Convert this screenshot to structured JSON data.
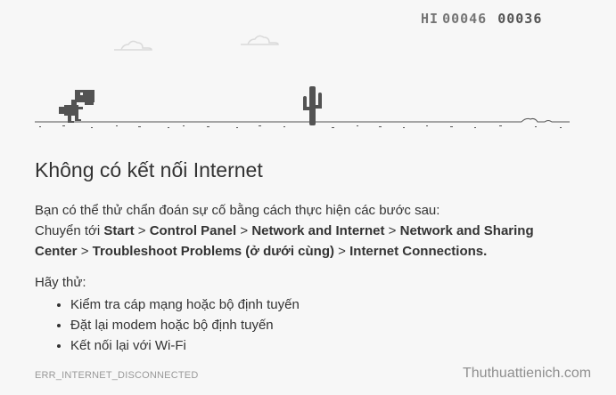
{
  "game": {
    "hi_label": "HI",
    "hi_score": "00046",
    "score": "00036"
  },
  "error": {
    "title": "Không có kết nối Internet",
    "intro": "Bạn có thể thử chẩn đoán sự cố bằng cách thực hiện các bước sau:",
    "path_prefix": "Chuyển tới",
    "path_start": "Start",
    "path_sep": ">",
    "path_control_panel": "Control Panel",
    "path_network_internet": "Network and Internet",
    "path_sharing_center": "Network and Sharing Center",
    "path_troubleshoot": "Troubleshoot Problems (ở dưới cùng)",
    "path_connections": "Internet Connections.",
    "try_label": "Hãy thử:",
    "suggestions": [
      "Kiểm tra cáp mạng hoặc bộ định tuyến",
      "Đặt lại modem hoặc bộ định tuyến",
      "Kết nối lại với Wi-Fi"
    ],
    "code": "ERR_INTERNET_DISCONNECTED"
  },
  "watermark": "Thuthuattienich.com"
}
